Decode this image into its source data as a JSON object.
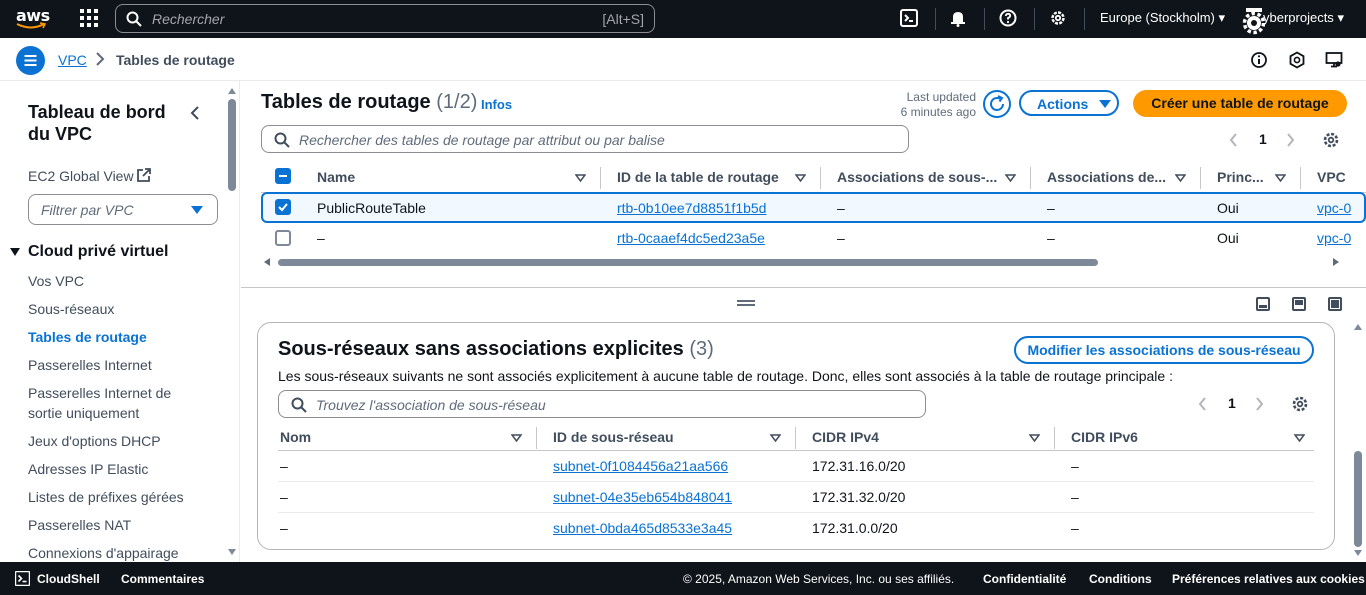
{
  "topnav": {
    "logo": "aws",
    "search_placeholder": "Rechercher",
    "search_shortcut": "[Alt+S]",
    "region": "Europe (Stockholm)",
    "account": "yberprojects",
    "icons": [
      "cloudshell-icon",
      "bell-icon",
      "help-icon",
      "settings-icon"
    ]
  },
  "breadcrumb": {
    "root": "VPC",
    "current": "Tables de routage"
  },
  "sidebar": {
    "title": "Tableau de bord du VPC",
    "global_view": "EC2 Global View",
    "filter_placeholder": "Filtrer par VPC",
    "section": "Cloud privé virtuel",
    "items": [
      {
        "label": "Vos VPC"
      },
      {
        "label": "Sous-réseaux"
      },
      {
        "label": "Tables de routage"
      },
      {
        "label": "Passerelles Internet"
      },
      {
        "label": "Passerelles Internet de sortie uniquement"
      },
      {
        "label": "Jeux d'options DHCP"
      },
      {
        "label": "Adresses IP Elastic"
      },
      {
        "label": "Listes de préfixes gérées"
      },
      {
        "label": "Passerelles NAT"
      },
      {
        "label": "Connexions d'appairage"
      }
    ]
  },
  "routetables": {
    "title": "Tables de routage",
    "count": "(1/2)",
    "info": "Infos",
    "last_updated_label": "Last updated",
    "last_updated_value": "6 minutes ago",
    "actions_label": "Actions",
    "create_label": "Créer une table de routage",
    "search_placeholder": "Rechercher des tables de routage par attribut ou par balise",
    "page": "1",
    "columns": [
      "Name",
      "ID de la table de routage",
      "Associations de sous-...",
      "Associations de...",
      "Princ...",
      "VPC"
    ],
    "rows": [
      {
        "name": "PublicRouteTable",
        "id": "rtb-0b10ee7d8851f1b5d",
        "subnet_assoc": "–",
        "edge_assoc": "–",
        "main": "Oui",
        "vpc": "vpc-0",
        "selected": true
      },
      {
        "name": "–",
        "id": "rtb-0caaef4dc5ed23a5e",
        "subnet_assoc": "–",
        "edge_assoc": "–",
        "main": "Oui",
        "vpc": "vpc-0",
        "selected": false
      }
    ]
  },
  "subnets": {
    "title": "Sous-réseaux sans associations explicites",
    "count": "(3)",
    "modify_label": "Modifier les associations de sous-réseau",
    "description": "Les sous-réseaux suivants ne sont associés explicitement à aucune table de routage. Donc, elles sont associés à la table de routage principale :",
    "search_placeholder": "Trouvez l'association de sous-réseau",
    "page": "1",
    "columns": [
      "Nom",
      "ID de sous-réseau",
      "CIDR IPv4",
      "CIDR IPv6"
    ],
    "rows": [
      {
        "name": "–",
        "id": "subnet-0f1084456a21aa566",
        "ipv4": "172.31.16.0/20",
        "ipv6": "–"
      },
      {
        "name": "–",
        "id": "subnet-04e35eb654b848041",
        "ipv4": "172.31.32.0/20",
        "ipv6": "–"
      },
      {
        "name": "–",
        "id": "subnet-0bda465d8533e3a45",
        "ipv4": "172.31.0.0/20",
        "ipv6": "–"
      }
    ]
  },
  "footer": {
    "cloudshell": "CloudShell",
    "feedback": "Commentaires",
    "copyright": "© 2025, Amazon Web Services, Inc. ou ses affiliés.",
    "privacy": "Confidentialité",
    "terms": "Conditions",
    "cookies": "Préférences relatives aux cookies"
  },
  "colors": {
    "accent": "#0972d3",
    "primary_button": "#ff9900",
    "topnav_bg": "#0f141a"
  }
}
